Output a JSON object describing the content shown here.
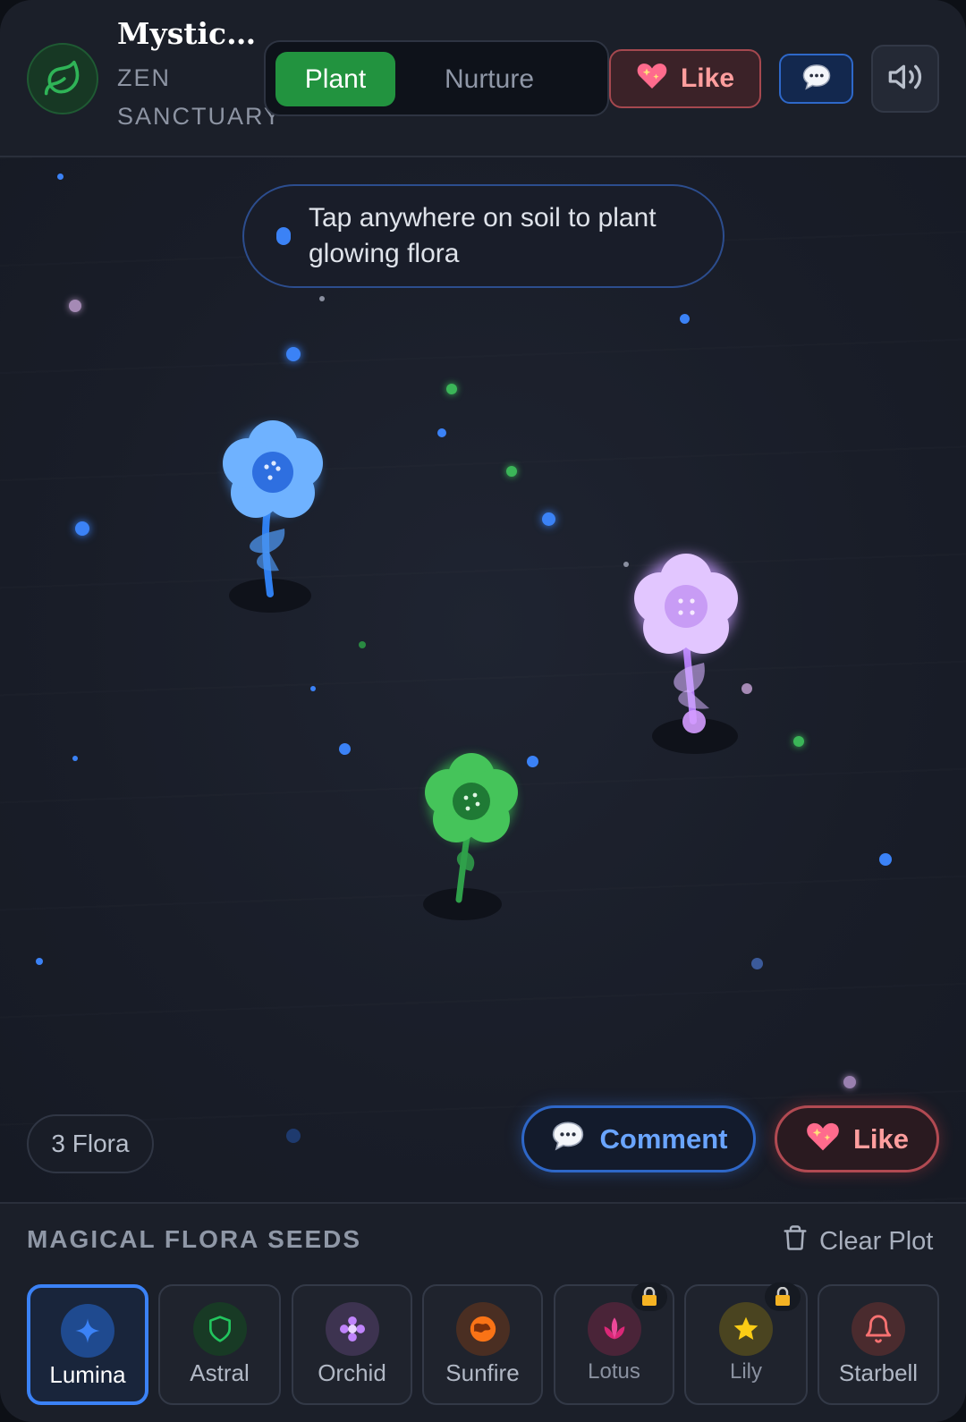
{
  "header": {
    "title": "Mystica…",
    "subtitle": "ZEN SANCTUARY",
    "logo_icon": "leaf-icon",
    "modes": [
      {
        "label": "Plant",
        "active": true
      },
      {
        "label": "Nurture",
        "active": false
      }
    ],
    "like_label": "Like",
    "like_icon": "sparkling-heart-icon",
    "chat_icon": "speech-bubble-icon",
    "sound_icon": "speaker-icon"
  },
  "garden": {
    "hint": "Tap anywhere on soil to plant glowing flora",
    "flowers": [
      {
        "name": "blue-flower",
        "color": "#5aa2ff"
      },
      {
        "name": "violet-flower",
        "color": "#d8a8ff"
      },
      {
        "name": "green-flower",
        "color": "#3cc25a"
      }
    ],
    "flora_count": "3 Flora",
    "comment_label": "Comment",
    "like_label": "Like"
  },
  "seeds": {
    "title": "MAGICAL FLORA SEEDS",
    "clear_label": "Clear Plot",
    "clear_icon": "trash-icon",
    "items": [
      {
        "label": "Lumina",
        "icon": "sparkle-icon",
        "color": "#3b82f6",
        "selected": true,
        "locked": false
      },
      {
        "label": "Astral",
        "icon": "shield-icon",
        "color": "#22c55e",
        "selected": false,
        "locked": false
      },
      {
        "label": "Orchid",
        "icon": "flower-icon",
        "color": "#c084fc",
        "selected": false,
        "locked": false
      },
      {
        "label": "Sunfire",
        "icon": "globe-icon",
        "color": "#f97316",
        "selected": false,
        "locked": false
      },
      {
        "label": "Lotus",
        "icon": "lotus-icon",
        "color": "#ec4899",
        "selected": false,
        "locked": true
      },
      {
        "label": "Lily",
        "icon": "star-icon",
        "color": "#facc15",
        "selected": false,
        "locked": true
      },
      {
        "label": "Starbell",
        "icon": "bell-icon",
        "color": "#f87171",
        "selected": false,
        "locked": false
      }
    ]
  },
  "colors": {
    "accent_green": "#22933f",
    "accent_blue": "#3b82f6",
    "accent_red": "#ef4444"
  }
}
